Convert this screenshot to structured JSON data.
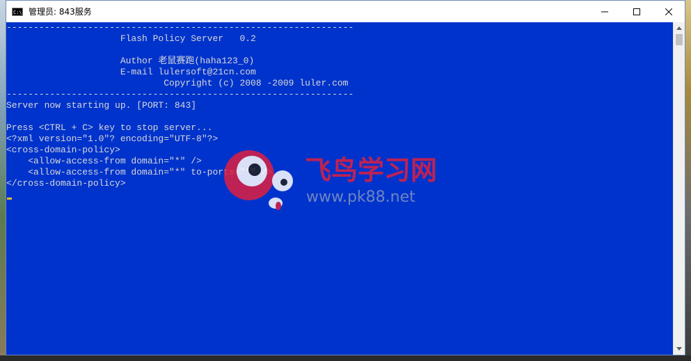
{
  "window": {
    "title": "管理员: 843服务",
    "icon_text": "C:\\"
  },
  "console": {
    "lines": [
      "----------------------------------------------------------------",
      "                     Flash Policy Server   0.2",
      "",
      "                     Author 老鼠赛跑(haha123_0)",
      "                     E-mail lulersoft@21cn.com",
      "                             Copyright (c) 2008 -2009 luler.com",
      "----------------------------------------------------------------",
      "Server now starting up. [PORT: 843]",
      "",
      "Press <CTRL + C> key to stop server...",
      "<?xml version=\"1.0\"? encoding=\"UTF-8\"?>",
      "<cross-domain-policy>",
      "    <allow-access-from domain=\"*\" />",
      "    <allow-access-from domain=\"*\" to-ports=\"*\" />",
      "</cross-domain-policy>"
    ]
  },
  "watermark": {
    "cn_text": "飞鸟学习网",
    "url_text": "www.pk88.net"
  },
  "colors": {
    "console_bg": "#0033cc",
    "console_fg": "#d8d8d8",
    "cursor": "#f0c020",
    "watermark_red": "#e02040"
  },
  "icons": {
    "app": "cmd-icon",
    "minimize": "minimize-icon",
    "maximize": "maximize-icon",
    "close": "close-icon",
    "scroll_up": "chevron-up-icon",
    "scroll_down": "chevron-down-icon"
  }
}
